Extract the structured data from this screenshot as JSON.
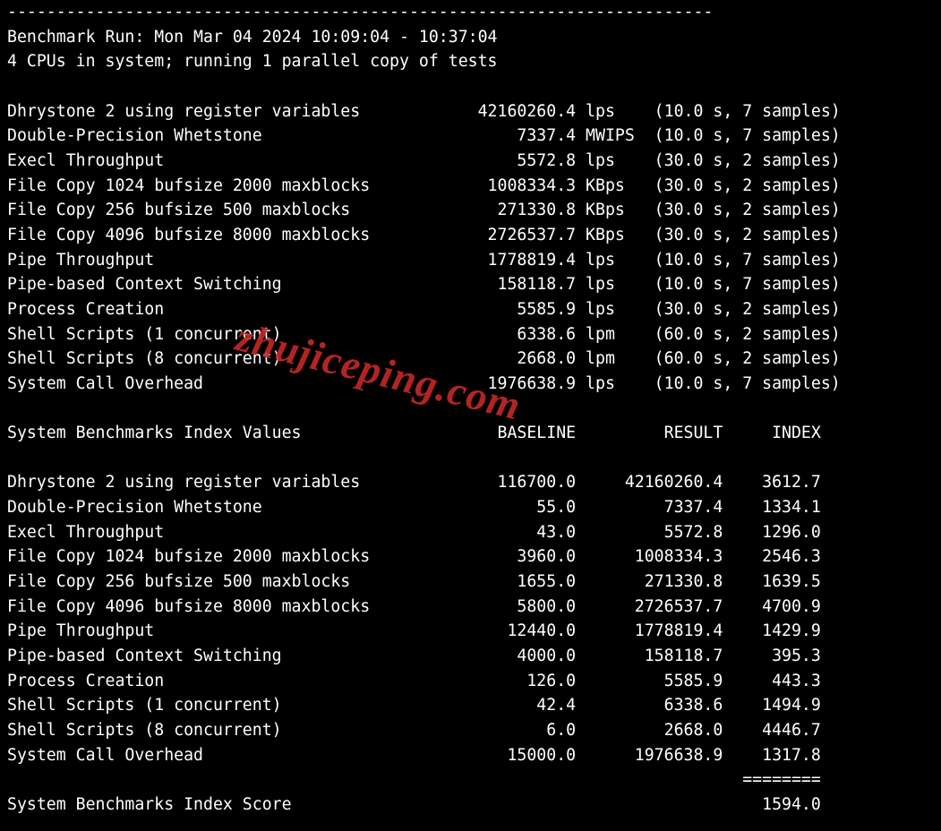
{
  "header": {
    "divider": "------------------------------------------------------------------------",
    "run_line": "Benchmark Run: Mon Mar 04 2024 10:09:04 - 10:37:04",
    "cpu_line": "4 CPUs in system; running 1 parallel copy of tests"
  },
  "tests": [
    {
      "name": "Dhrystone 2 using register variables",
      "value": "42160260.4",
      "unit": "lps",
      "timing": "(10.0 s, 7 samples)"
    },
    {
      "name": "Double-Precision Whetstone",
      "value": "7337.4",
      "unit": "MWIPS",
      "timing": "(10.0 s, 7 samples)"
    },
    {
      "name": "Execl Throughput",
      "value": "5572.8",
      "unit": "lps",
      "timing": "(30.0 s, 2 samples)"
    },
    {
      "name": "File Copy 1024 bufsize 2000 maxblocks",
      "value": "1008334.3",
      "unit": "KBps",
      "timing": "(30.0 s, 2 samples)"
    },
    {
      "name": "File Copy 256 bufsize 500 maxblocks",
      "value": "271330.8",
      "unit": "KBps",
      "timing": "(30.0 s, 2 samples)"
    },
    {
      "name": "File Copy 4096 bufsize 8000 maxblocks",
      "value": "2726537.7",
      "unit": "KBps",
      "timing": "(30.0 s, 2 samples)"
    },
    {
      "name": "Pipe Throughput",
      "value": "1778819.4",
      "unit": "lps",
      "timing": "(10.0 s, 7 samples)"
    },
    {
      "name": "Pipe-based Context Switching",
      "value": "158118.7",
      "unit": "lps",
      "timing": "(10.0 s, 7 samples)"
    },
    {
      "name": "Process Creation",
      "value": "5585.9",
      "unit": "lps",
      "timing": "(30.0 s, 2 samples)"
    },
    {
      "name": "Shell Scripts (1 concurrent)",
      "value": "6338.6",
      "unit": "lpm",
      "timing": "(60.0 s, 2 samples)"
    },
    {
      "name": "Shell Scripts (8 concurrent)",
      "value": "2668.0",
      "unit": "lpm",
      "timing": "(60.0 s, 2 samples)"
    },
    {
      "name": "System Call Overhead",
      "value": "1976638.9",
      "unit": "lps",
      "timing": "(10.0 s, 7 samples)"
    }
  ],
  "index_header": {
    "title": "System Benchmarks Index Values",
    "col_baseline": "BASELINE",
    "col_result": "RESULT",
    "col_index": "INDEX"
  },
  "index_rows": [
    {
      "name": "Dhrystone 2 using register variables",
      "baseline": "116700.0",
      "result": "42160260.4",
      "index": "3612.7"
    },
    {
      "name": "Double-Precision Whetstone",
      "baseline": "55.0",
      "result": "7337.4",
      "index": "1334.1"
    },
    {
      "name": "Execl Throughput",
      "baseline": "43.0",
      "result": "5572.8",
      "index": "1296.0"
    },
    {
      "name": "File Copy 1024 bufsize 2000 maxblocks",
      "baseline": "3960.0",
      "result": "1008334.3",
      "index": "2546.3"
    },
    {
      "name": "File Copy 256 bufsize 500 maxblocks",
      "baseline": "1655.0",
      "result": "271330.8",
      "index": "1639.5"
    },
    {
      "name": "File Copy 4096 bufsize 8000 maxblocks",
      "baseline": "5800.0",
      "result": "2726537.7",
      "index": "4700.9"
    },
    {
      "name": "Pipe Throughput",
      "baseline": "12440.0",
      "result": "1778819.4",
      "index": "1429.9"
    },
    {
      "name": "Pipe-based Context Switching",
      "baseline": "4000.0",
      "result": "158118.7",
      "index": "395.3"
    },
    {
      "name": "Process Creation",
      "baseline": "126.0",
      "result": "5585.9",
      "index": "443.3"
    },
    {
      "name": "Shell Scripts (1 concurrent)",
      "baseline": "42.4",
      "result": "6338.6",
      "index": "1494.9"
    },
    {
      "name": "Shell Scripts (8 concurrent)",
      "baseline": "6.0",
      "result": "2668.0",
      "index": "4446.7"
    },
    {
      "name": "System Call Overhead",
      "baseline": "15000.0",
      "result": "1976638.9",
      "index": "1317.8"
    }
  ],
  "score": {
    "divider": "========",
    "label": "System Benchmarks Index Score",
    "value": "1594.0"
  },
  "watermark": "zhujiceping.com"
}
